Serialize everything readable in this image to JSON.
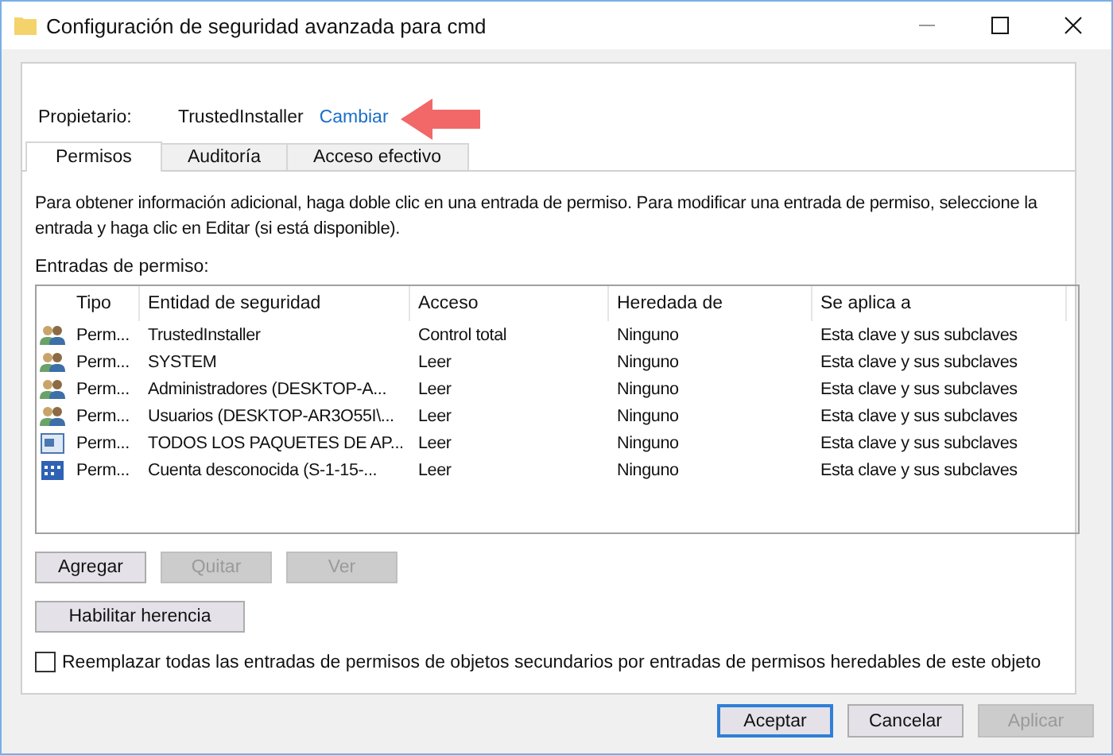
{
  "window": {
    "title": "Configuración de seguridad avanzada para cmd"
  },
  "owner": {
    "label": "Propietario:",
    "value": "TrustedInstaller",
    "link": "Cambiar"
  },
  "tabs": [
    {
      "label": "Permisos",
      "selected": true
    },
    {
      "label": "Auditoría",
      "selected": false
    },
    {
      "label": "Acceso efectivo",
      "selected": false
    }
  ],
  "info": "Para obtener información adicional, haga doble clic en una entrada de permiso. Para modificar una entrada de permiso, seleccione la entrada y haga clic en Editar (si está disponible).",
  "list_label": "Entradas de permiso:",
  "table": {
    "columns": [
      "Tipo",
      "Entidad de seguridad",
      "Acceso",
      "Heredada de",
      "Se aplica a"
    ],
    "rows": [
      {
        "kind": "group",
        "cells": [
          "Perm...",
          "TrustedInstaller",
          "Control total",
          "Ninguno",
          "Esta clave y sus subclaves"
        ]
      },
      {
        "kind": "group",
        "cells": [
          "Perm...",
          "SYSTEM",
          "Leer",
          "Ninguno",
          "Esta clave y sus subclaves"
        ]
      },
      {
        "kind": "group",
        "cells": [
          "Perm...",
          "Administradores (DESKTOP-A...",
          "Leer",
          "Ninguno",
          "Esta clave y sus subclaves"
        ]
      },
      {
        "kind": "group",
        "cells": [
          "Perm...",
          "Usuarios (DESKTOP-AR3O55I\\...",
          "Leer",
          "Ninguno",
          "Esta clave y sus subclaves"
        ]
      },
      {
        "kind": "package",
        "cells": [
          "Perm...",
          "TODOS LOS PAQUETES DE AP...",
          "Leer",
          "Ninguno",
          "Esta clave y sus subclaves"
        ]
      },
      {
        "kind": "unknown",
        "cells": [
          "Perm...",
          "Cuenta desconocida (S-1-15-...",
          "Leer",
          "Ninguno",
          "Esta clave y sus subclaves"
        ]
      }
    ]
  },
  "entry_buttons": [
    {
      "label": "Agregar",
      "disabled": false
    },
    {
      "label": "Quitar",
      "disabled": true
    },
    {
      "label": "Ver",
      "disabled": true
    }
  ],
  "inherit_button": {
    "label": "Habilitar herencia",
    "disabled": false
  },
  "replace_checkbox": {
    "label": "Reemplazar todas las entradas de permisos de objetos secundarios por entradas de permisos heredables de este objeto",
    "checked": false
  },
  "dialog_buttons": [
    {
      "label": "Aceptar",
      "disabled": false,
      "default": true
    },
    {
      "label": "Cancelar",
      "disabled": false,
      "default": false
    },
    {
      "label": "Aplicar",
      "disabled": true,
      "default": false
    }
  ]
}
